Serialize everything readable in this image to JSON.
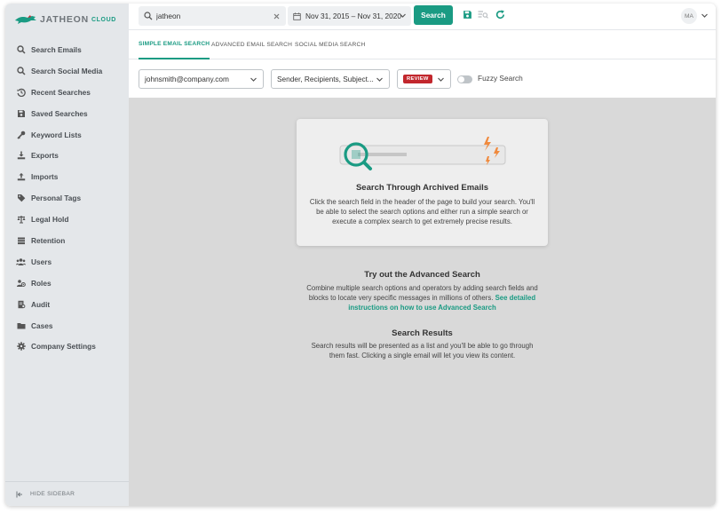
{
  "brand": {
    "name": "JATHEON",
    "suffix": "CLOUD",
    "accent": "#1a9b83"
  },
  "sidebar": {
    "items": [
      {
        "label": "Search Emails",
        "icon": "search-icon"
      },
      {
        "label": "Search Social Media",
        "icon": "search-icon"
      },
      {
        "label": "Recent Searches",
        "icon": "history-icon"
      },
      {
        "label": "Saved Searches",
        "icon": "save-icon"
      },
      {
        "label": "Keyword Lists",
        "icon": "key-icon"
      },
      {
        "label": "Exports",
        "icon": "export-icon"
      },
      {
        "label": "Imports",
        "icon": "import-icon"
      },
      {
        "label": "Personal Tags",
        "icon": "tag-icon"
      },
      {
        "label": "Legal Hold",
        "icon": "scale-icon"
      },
      {
        "label": "Retention",
        "icon": "retention-icon"
      },
      {
        "label": "Users",
        "icon": "users-icon"
      },
      {
        "label": "Roles",
        "icon": "roles-icon"
      },
      {
        "label": "Audit",
        "icon": "audit-icon"
      },
      {
        "label": "Cases",
        "icon": "folder-icon"
      },
      {
        "label": "Company Settings",
        "icon": "gear-icon"
      }
    ],
    "hide_label": "HIDE SIDEBAR"
  },
  "header": {
    "search_value": "jatheon",
    "date_range": "Nov 31, 2015 – Nov 31, 2020",
    "search_button": "Search",
    "avatar_initials": "MA"
  },
  "tabs": [
    {
      "label": "SIMPLE EMAIL SEARCH",
      "active": true
    },
    {
      "label": "ADVANCED EMAIL SEARCH",
      "active": false
    },
    {
      "label": "SOCIAL MEDIA SEARCH",
      "active": false
    }
  ],
  "filters": {
    "email": "johnsmith@company.com",
    "fields": "Sender, Recipients, Subject...",
    "status_badge": "REVIEW",
    "fuzzy_label": "Fuzzy Search",
    "fuzzy_on": false
  },
  "main": {
    "card_title": "Search Through Archived Emails",
    "card_body": "Click the search field in the header of the page to build your search. You'll be able to select the search options and either run a simple search or execute a complex search to get extremely precise results.",
    "advanced_title": "Try out the Advanced Search",
    "advanced_body": "Combine multiple search options and operators by adding search fields and blocks to locate very specific messages in millions of others.",
    "advanced_link": "See detailed instructions on how to use Advanced Search",
    "results_title": "Search Results",
    "results_body": "Search results will be presented as a list and you'll be able to go through them fast. Clicking a single email will let you view its content."
  }
}
